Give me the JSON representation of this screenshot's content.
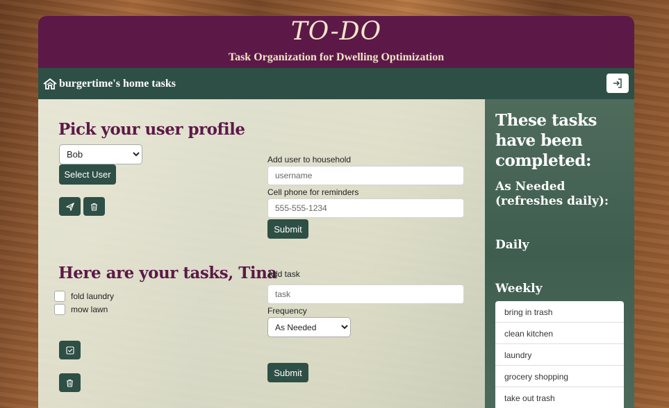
{
  "banner": {
    "title": "TO-DO",
    "subtitle": "Task Organization for Dwelling Optimization"
  },
  "navbar": {
    "brand": "burgertime's home tasks",
    "icon": "house-icon",
    "login_icon": "login-icon"
  },
  "profile": {
    "heading": "Pick your user profile",
    "selected_user": "Bob",
    "select_button": "Select User",
    "send_icon": "send-icon",
    "delete_icon": "trash-icon"
  },
  "add_user": {
    "label": "Add user to household",
    "username_placeholder": "username",
    "phone_label": "Cell phone for reminders",
    "phone_placeholder": "555-555-1234",
    "submit": "Submit"
  },
  "tasks": {
    "heading": "Here are your tasks, Tina",
    "items": [
      {
        "label": "fold laundry"
      },
      {
        "label": "mow lawn"
      }
    ],
    "complete_icon": "check-square-icon",
    "delete_icon": "trash-icon"
  },
  "add_task": {
    "label": "Add task",
    "task_placeholder": "task",
    "frequency_label": "Frequency",
    "frequency_value": "As Needed",
    "submit": "Submit"
  },
  "completed": {
    "heading": "These tasks have been completed:",
    "sections": [
      {
        "title": "As Needed (refreshes daily):"
      },
      {
        "title": "Daily"
      },
      {
        "title": "Weekly"
      }
    ],
    "weekly_items": [
      {
        "label": "bring in trash"
      },
      {
        "label": "clean kitchen"
      },
      {
        "label": "laundry"
      },
      {
        "label": "grocery shopping"
      },
      {
        "label": "take out trash"
      }
    ]
  },
  "colors": {
    "banner": "#5c1947",
    "navbar": "#2e4f45",
    "heading": "#5c1947",
    "sidebar": "#3f5e50"
  }
}
